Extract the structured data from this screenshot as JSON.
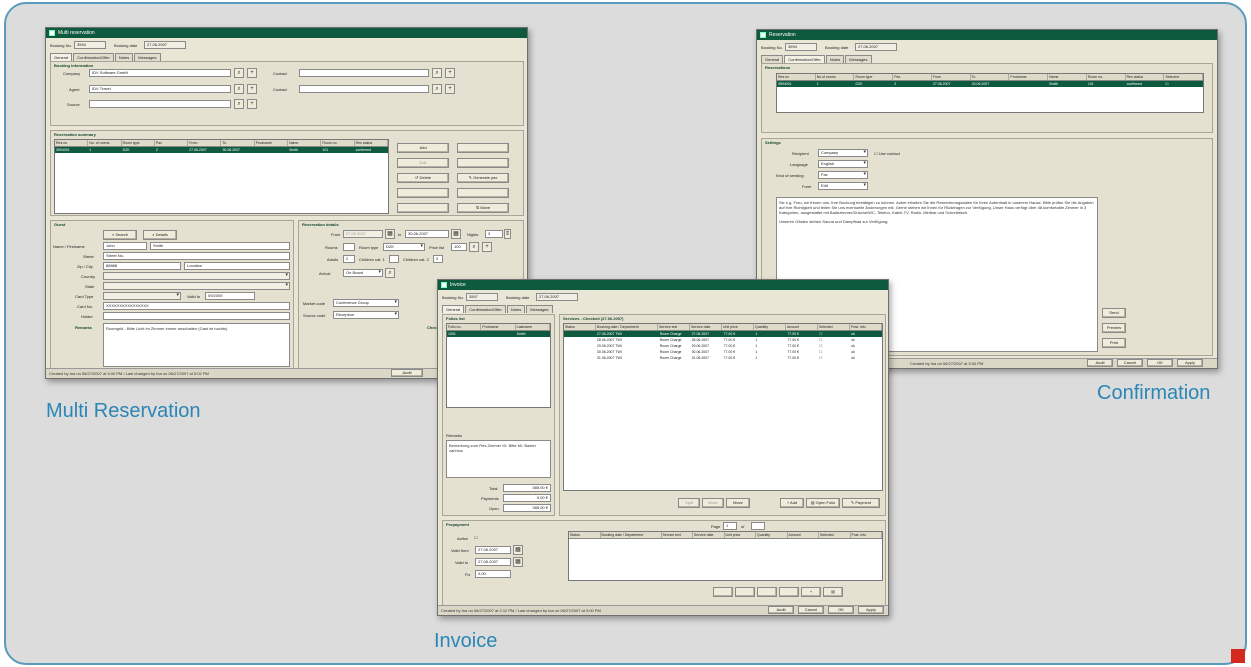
{
  "captions": {
    "multi": "Multi Reservation",
    "confirmation": "Confirmation",
    "invoice": "Invoice"
  },
  "colors": {
    "panel_bg": "#dcdcdc",
    "panel_border": "#5a9bbd",
    "caption": "#2a86b5",
    "titlebar": "#0d5a3e",
    "window_bg": "#e9e6d6",
    "accent_square": "#d42a1e"
  },
  "multi": {
    "title": "Multi reservation",
    "booking_no_label": "Booking No.",
    "booking_no": "3594",
    "booking_date_label": "Booking date",
    "booking_date": "27.06.2007",
    "tabs": [
      "General",
      "Confirmation/Offer",
      "Notes",
      "Messages"
    ],
    "booking_info_title": "Booking information",
    "company_label": "Company",
    "company_value": "IDV Software GmbH",
    "contact_label": "Contact",
    "agent_label": "Agent",
    "agent_value": "IDV Travel",
    "source_label": "Source",
    "reservation_summary_title": "Reservation summary",
    "summary_columns": [
      "Res.no",
      "No. of rooms",
      "Room type",
      "Pax",
      "From",
      "To",
      "Prodname",
      "Name",
      "Room no.",
      "Res status"
    ],
    "summary_rows": [
      [
        "3594001",
        "1",
        "DZK",
        "2",
        "27.06.2007",
        "30.06.2007",
        "",
        "Smith",
        "101",
        "confirmed"
      ]
    ],
    "side_buttons": [
      "Add",
      "Edit",
      "",
      "Delete",
      "",
      "Generate pax",
      "",
      "",
      "",
      "Move"
    ],
    "guest_title": "Guest",
    "search_label": "Search",
    "details_label": "Details",
    "guest_fields": [
      {
        "label": "Name / Firstname",
        "value": "John",
        "value2": "Smith"
      },
      {
        "label": "Street",
        "value": "Street No."
      },
      {
        "label": "Zip / City",
        "value": "88888",
        "value2": "Location"
      },
      {
        "label": "Country",
        "value": ""
      },
      {
        "label": "State",
        "value": ""
      },
      {
        "label": "Card Type",
        "value": "",
        "label2": "Valid to",
        "value2": "09/2009"
      },
      {
        "label": "Card No.",
        "value": "XXXXXXXXXXXXXXXX"
      },
      {
        "label": "Holder",
        "value": ""
      }
    ],
    "remarks_label": "Remarks",
    "remarks_value": "Roomgrid - Bitte Licht im Zimmer immer anschalten (Gast ist nachts)",
    "res_details_title": "Reservation details",
    "from_label": "From",
    "from_value": "27.06.2007",
    "to_label": "to",
    "to_value": "30.06.2007",
    "nights_label": "Nights",
    "nights_value": "3",
    "rooms_label": "Rooms",
    "room_type_label": "Room type",
    "room_type_value": "DZK",
    "price_list_label": "Price list",
    "price_list_value": "100",
    "adults_label": "Adults",
    "adults_value": "2",
    "children1_label": "Children cat. 1",
    "children2_label": "Children cat. 2",
    "children2_value": "0",
    "arrival_label": "Arrival",
    "arrival_value": "On Board",
    "market_label": "Market code",
    "market_value": "Conference Group",
    "source_code_label": "Source code",
    "source_code_value": "Reception",
    "check_in_label": "Check in",
    "status_line": "Created by Ina on 06/27/2007 at 5:00 PM / Last changed by Ina on 06/27/2007 at 5:02 PM",
    "audit_label": "Audit"
  },
  "confirmation": {
    "title": "Reservation",
    "booking_no_label": "Booking No.",
    "booking_no": "3594",
    "booking_date_label": "Booking date",
    "booking_date": "27.06.2007",
    "tabs": [
      "General",
      "Confirmation/Offer",
      "Notes",
      "Messages"
    ],
    "reservations_title": "Reservations",
    "columns": [
      "Res.no",
      "No.of rooms",
      "Room type",
      "Pax",
      "From",
      "To",
      "Prodname",
      "Name",
      "Room no.",
      "Res status",
      "Selected"
    ],
    "rows": [
      [
        "3594001",
        "1",
        "DZK",
        "2",
        "27.06.2007",
        "30.06.2007",
        "",
        "Smith",
        "101",
        "confirmed",
        ""
      ]
    ],
    "settings_title": "Settings",
    "recipient_label": "Recipient",
    "recipient_value": "Company",
    "use_contact_label": "Use contact",
    "language_label": "Language",
    "language_value": "English",
    "kind_label": "Kind of sending",
    "kind_value": "Fax",
    "form_label": "Form",
    "form_value": "Edit",
    "letter_text": "Sie s.g. Frau, wir freuen uns, Ihre Buchung bestätigen zu können. Anbei erhalten Sie die Reservierungsdaten für Ihren Aufenthalt in unserem Hause. Bitte prüfen Sie die Angaben auf ihre Richtigkeit und teilen Sie uns eventuelle Änderungen mit. Gerne stehen wir Ihnen für Rückfragen zur Verfügung. Unser Haus verfügt über 48 komfortable Zimmer in 3 Kategorien, ausgestattet mit Badezimmer/Dusche/WC, Telefon, Kabel-TV, Radio, Minibar und Schreibtisch.",
    "letter_text2": "Unseren Gästen stehen Sauna und Dampfbad zur Verfügung.",
    "buttons": [
      "Send",
      "Preview",
      "Print"
    ],
    "status_line": "Created by Ina on 06/27/2007 at 5:00 PM",
    "bottom_buttons": [
      "Audit",
      "Cancel",
      "OK",
      "Apply"
    ]
  },
  "invoice": {
    "title": "Invoice",
    "booking_no_label": "Booking No.",
    "booking_no": "3597",
    "booking_date_label": "Booking date",
    "booking_date": "27.06.2007",
    "tabs": [
      "General",
      "Confirmation/Offer",
      "Notes",
      "Messages"
    ],
    "panel_list_title": "Folios list",
    "folio_columns": [
      "Folio no.",
      "Prodname",
      "Lastname"
    ],
    "folio_rows": [
      [
        "1001",
        "",
        "Smith"
      ]
    ],
    "services_title": "Services - Checked (27.06.2007)",
    "service_columns": [
      "Status",
      "Booking date / Department",
      "Service text",
      "Service date",
      "Unit price",
      "Quantity",
      "Amount",
      "Selected",
      "Post. info"
    ],
    "service_rows": [
      [
        "",
        "27.06.2007 TWI",
        "Room Charge",
        "27.06.2007",
        "77.00 €",
        "1",
        "77.00 €",
        "",
        "ok"
      ],
      [
        "",
        "28.06.2007 TWI",
        "Room Charge",
        "28.06.2007",
        "77.00 €",
        "1",
        "77.00 €",
        "",
        "ok"
      ],
      [
        "",
        "29.06.2007 TWI",
        "Room Charge",
        "29.06.2007",
        "77.00 €",
        "1",
        "77.00 €",
        "",
        "ok"
      ],
      [
        "",
        "30.06.2007 TWI",
        "Room Charge",
        "30.06.2007",
        "77.00 €",
        "1",
        "77.00 €",
        "",
        "ok"
      ],
      [
        "",
        "31.06.2007 TWI",
        "Room Charge",
        "31.06.2007",
        "77.00 €",
        "1",
        "77.00 €",
        "",
        "ok"
      ]
    ],
    "remarks_label": "Remarks",
    "remarks_value": "Bemerkung zum Res-Zimmer ID: Bitte Mr. Baxter zahnlos",
    "total_label": "Total",
    "total_value": "385,00 €",
    "payments_label": "Payments",
    "payments_value": "0,00 €",
    "open_label": "Open",
    "open_value": "385,00 €",
    "service_buttons": [
      "Split",
      "Move",
      "Move",
      "Add",
      "Open Folio",
      "Payment"
    ],
    "pagination_label": "Page",
    "page_value": "1",
    "of_label": "of",
    "prepayment_title": "Prepayment",
    "active_label": "Active",
    "valid_from_label": "Valid from",
    "valid_from_value": "27.06.2007",
    "valid_to_label": "Valid to",
    "valid_to_value": "27.06.2007",
    "fix_label": "Fix",
    "fix_value": "0,00",
    "prepay_columns": [
      "Status",
      "Booking date / Department",
      "Service text",
      "Service date",
      "Unit price",
      "Quantity",
      "Amount",
      "Selected",
      "Post. info"
    ],
    "status_line": "Created by Ina on 06/27/2007 at 2:12 PM / Last changed by Ina on 06/27/2007 at 3:00 PM",
    "bottom_buttons": [
      "Audit",
      "Cancel",
      "OK",
      "Apply"
    ]
  }
}
